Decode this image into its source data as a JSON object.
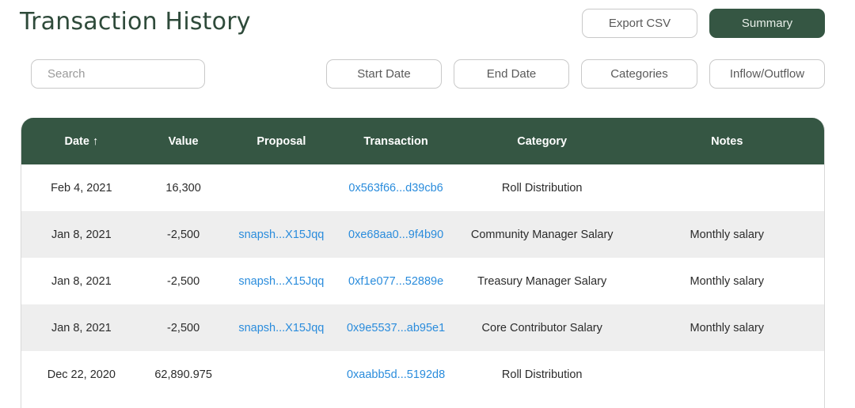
{
  "header": {
    "title": "Transaction History",
    "export_label": "Export CSV",
    "summary_label": "Summary"
  },
  "filters": {
    "search_placeholder": "Search",
    "start_date": "Start Date",
    "end_date": "End Date",
    "categories": "Categories",
    "inflow_outflow": "Inflow/Outflow"
  },
  "table": {
    "columns": [
      "Date ↑",
      "Value",
      "Proposal",
      "Transaction",
      "Category",
      "Notes"
    ],
    "rows": [
      {
        "date": "Feb 4, 2021",
        "value": "16,300",
        "proposal": "",
        "transaction": "0x563f66...d39cb6",
        "category": "Roll Distribution",
        "notes": ""
      },
      {
        "date": "Jan 8, 2021",
        "value": "-2,500",
        "proposal": "snapsh...X15Jqq",
        "transaction": "0xe68aa0...9f4b90",
        "category": "Community Manager Salary",
        "notes": "Monthly salary"
      },
      {
        "date": "Jan 8, 2021",
        "value": "-2,500",
        "proposal": "snapsh...X15Jqq",
        "transaction": "0xf1e077...52889e",
        "category": "Treasury Manager Salary",
        "notes": "Monthly salary"
      },
      {
        "date": "Jan 8, 2021",
        "value": "-2,500",
        "proposal": "snapsh...X15Jqq",
        "transaction": "0x9e5537...ab95e1",
        "category": "Core Contributor Salary",
        "notes": "Monthly salary"
      },
      {
        "date": "Dec 22, 2020",
        "value": "62,890.975",
        "proposal": "",
        "transaction": "0xaabb5d...5192d8",
        "category": "Roll Distribution",
        "notes": ""
      }
    ]
  },
  "colors": {
    "primary": "#355643",
    "title": "#2e4a3a",
    "link": "#2a8cdc",
    "row_alt": "#eeeeee"
  }
}
